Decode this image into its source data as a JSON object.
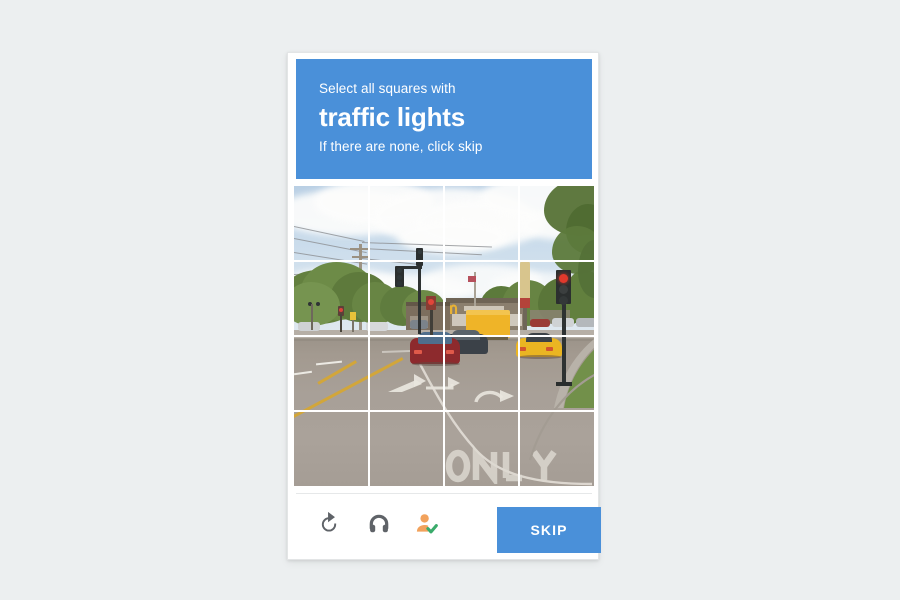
{
  "background_color": "#eceff0",
  "card": {
    "accent_color": "#4a90d9",
    "background_color": "#ffffff"
  },
  "header": {
    "instruction_prefix": "Select all squares with",
    "target_object": "traffic lights",
    "instruction_suffix": "If there are none, click skip",
    "background_color": "#4a90d9",
    "text_color": "#ffffff"
  },
  "challenge": {
    "type": "image-grid",
    "rows": 4,
    "columns": 4,
    "total_tiles": 16,
    "grid_line_color": "#ffffff",
    "scene_description": "Street intersection with traffic lights, cars, a yellow box truck, a McDonald's restaurant, trees and clouds",
    "tiles": [
      {
        "index": 1,
        "row": 1,
        "column": 1,
        "selected": false,
        "content": "cloudy sky"
      },
      {
        "index": 2,
        "row": 1,
        "column": 2,
        "selected": false,
        "content": "cloudy sky"
      },
      {
        "index": 3,
        "row": 1,
        "column": 3,
        "selected": false,
        "content": "cloudy sky"
      },
      {
        "index": 4,
        "row": 1,
        "column": 4,
        "selected": false,
        "content": "sky and tree branches"
      },
      {
        "index": 5,
        "row": 2,
        "column": 1,
        "selected": false,
        "content": "trees and utility pole"
      },
      {
        "index": 6,
        "row": 2,
        "column": 2,
        "selected": false,
        "content": "traffic light on mast arm"
      },
      {
        "index": 7,
        "row": 2,
        "column": 3,
        "selected": false,
        "content": "McDonald's restaurant and sign"
      },
      {
        "index": 8,
        "row": 2,
        "column": 4,
        "selected": false,
        "content": "traffic light with red signal"
      },
      {
        "index": 9,
        "row": 3,
        "column": 1,
        "selected": false,
        "content": "road and lane markings"
      },
      {
        "index": 10,
        "row": 3,
        "column": 2,
        "selected": false,
        "content": "road with turn arrow"
      },
      {
        "index": 11,
        "row": 3,
        "column": 3,
        "selected": false,
        "content": "red car and dark car"
      },
      {
        "index": 12,
        "row": 3,
        "column": 4,
        "selected": false,
        "content": "yellow sports car and grass median"
      },
      {
        "index": 13,
        "row": 4,
        "column": 1,
        "selected": false,
        "content": "road pavement with yellow line"
      },
      {
        "index": 14,
        "row": 4,
        "column": 2,
        "selected": false,
        "content": "road pavement"
      },
      {
        "index": 15,
        "row": 4,
        "column": 3,
        "selected": false,
        "content": "road pavement with ONLY marking"
      },
      {
        "index": 16,
        "row": 4,
        "column": 4,
        "selected": false,
        "content": "road pavement with marking"
      }
    ]
  },
  "footer": {
    "buttons": [
      {
        "name": "refresh",
        "icon": "refresh-icon",
        "title": "Get a new challenge",
        "color": "#5f6368"
      },
      {
        "name": "audio",
        "icon": "headphones-icon",
        "title": "Get an audio challenge",
        "color": "#5f6368"
      },
      {
        "name": "info",
        "icon": "person-check-icon",
        "title": "Privacy and terms",
        "color": "#f0a35e"
      }
    ],
    "skip_label": "SKIP",
    "skip_color": "#4a90d9"
  }
}
